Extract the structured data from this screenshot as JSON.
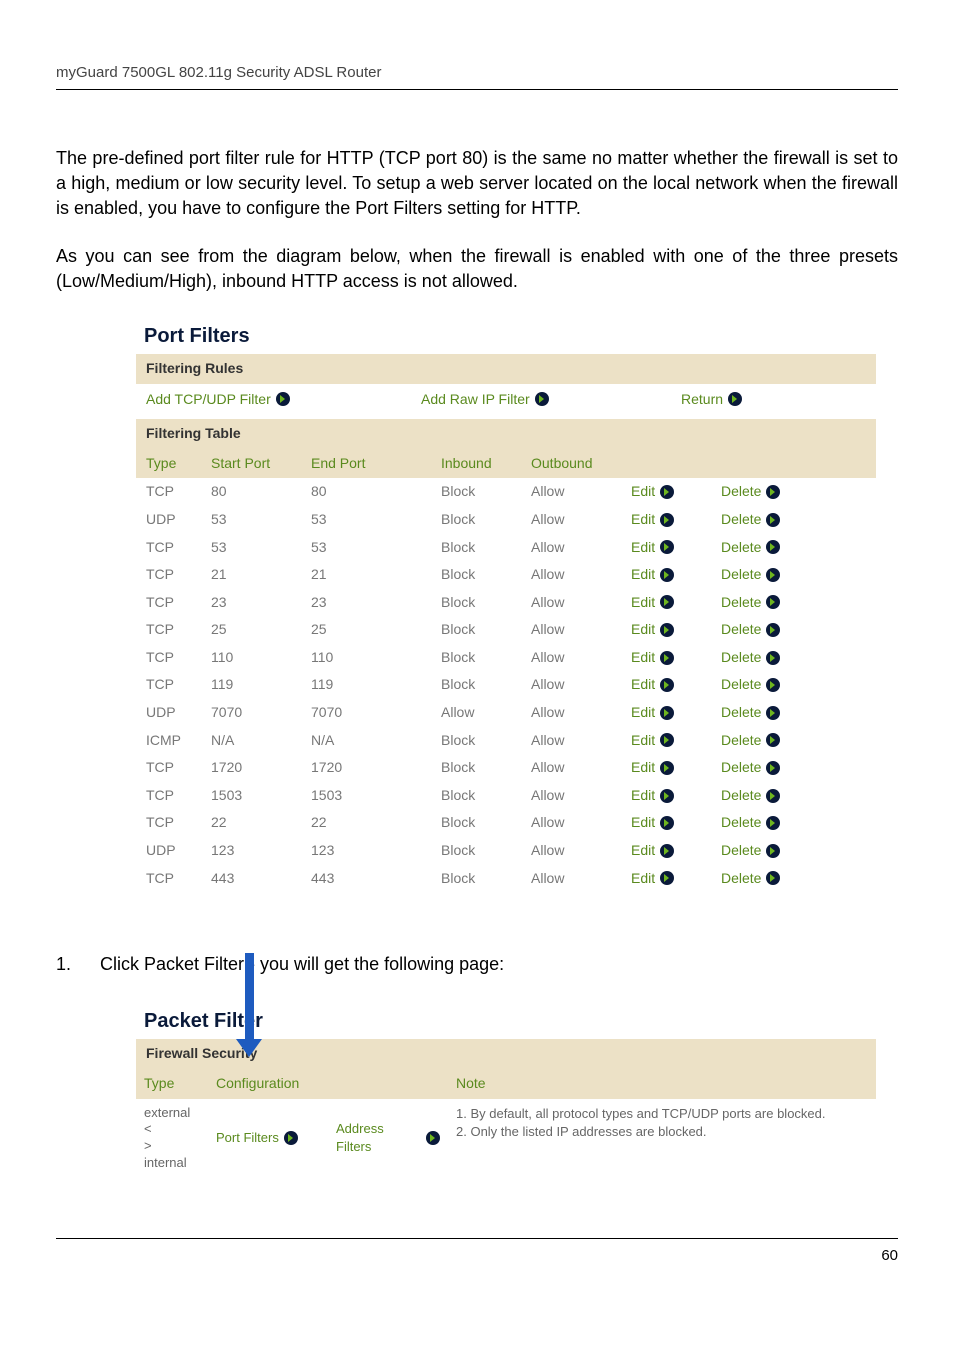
{
  "header": "myGuard 7500GL 802.11g Security ADSL Router",
  "para1": "The pre-defined port filter rule for HTTP (TCP port 80) is the same no matter whether the firewall is set to a high, medium or low security level. To setup a web server located on the local network when the firewall is enabled, you have to configure the Port Filters setting for HTTP.",
  "para2": "As you can see from the diagram below, when the firewall is enabled with one of the three presets (Low/Medium/High), inbound HTTP access is not allowed.",
  "portFilters": {
    "title": "Port Filters",
    "rulesHead": "Filtering Rules",
    "links": {
      "addTcp": "Add TCP/UDP Filter",
      "addRaw": "Add Raw IP Filter",
      "ret": "Return"
    },
    "tableHead": "Filtering Table",
    "cols": {
      "type": "Type",
      "start": "Start Port",
      "end": "End Port",
      "in": "Inbound",
      "out": "Outbound"
    },
    "editLabel": "Edit",
    "deleteLabel": "Delete",
    "rows": [
      {
        "type": "TCP",
        "start": "80",
        "end": "80",
        "in": "Block",
        "out": "Allow"
      },
      {
        "type": "UDP",
        "start": "53",
        "end": "53",
        "in": "Block",
        "out": "Allow"
      },
      {
        "type": "TCP",
        "start": "53",
        "end": "53",
        "in": "Block",
        "out": "Allow"
      },
      {
        "type": "TCP",
        "start": "21",
        "end": "21",
        "in": "Block",
        "out": "Allow"
      },
      {
        "type": "TCP",
        "start": "23",
        "end": "23",
        "in": "Block",
        "out": "Allow"
      },
      {
        "type": "TCP",
        "start": "25",
        "end": "25",
        "in": "Block",
        "out": "Allow"
      },
      {
        "type": "TCP",
        "start": "110",
        "end": "110",
        "in": "Block",
        "out": "Allow"
      },
      {
        "type": "TCP",
        "start": "119",
        "end": "119",
        "in": "Block",
        "out": "Allow"
      },
      {
        "type": "UDP",
        "start": "7070",
        "end": "7070",
        "in": "Allow",
        "out": "Allow"
      },
      {
        "type": "ICMP",
        "start": "N/A",
        "end": "N/A",
        "in": "Block",
        "out": "Allow"
      },
      {
        "type": "TCP",
        "start": "1720",
        "end": "1720",
        "in": "Block",
        "out": "Allow"
      },
      {
        "type": "TCP",
        "start": "1503",
        "end": "1503",
        "in": "Block",
        "out": "Allow"
      },
      {
        "type": "TCP",
        "start": "22",
        "end": "22",
        "in": "Block",
        "out": "Allow"
      },
      {
        "type": "UDP",
        "start": "123",
        "end": "123",
        "in": "Block",
        "out": "Allow"
      },
      {
        "type": "TCP",
        "start": "443",
        "end": "443",
        "in": "Block",
        "out": "Allow"
      }
    ]
  },
  "step": {
    "num": "1.",
    "text": "Click Packet Filter - you will get the following page:"
  },
  "packetFilter": {
    "title": "Packet Filter",
    "sub": "Firewall Security",
    "cols": {
      "type": "Type",
      "config": "Configuration",
      "note": "Note"
    },
    "row": {
      "type": "external < > internal",
      "portFilters": "Port Filters",
      "addrFilters": "Address Filters",
      "note": "1. By default, all protocol types and TCP/UDP ports are blocked.\n2. Only the listed IP addresses are blocked."
    }
  },
  "pageNumber": "60"
}
